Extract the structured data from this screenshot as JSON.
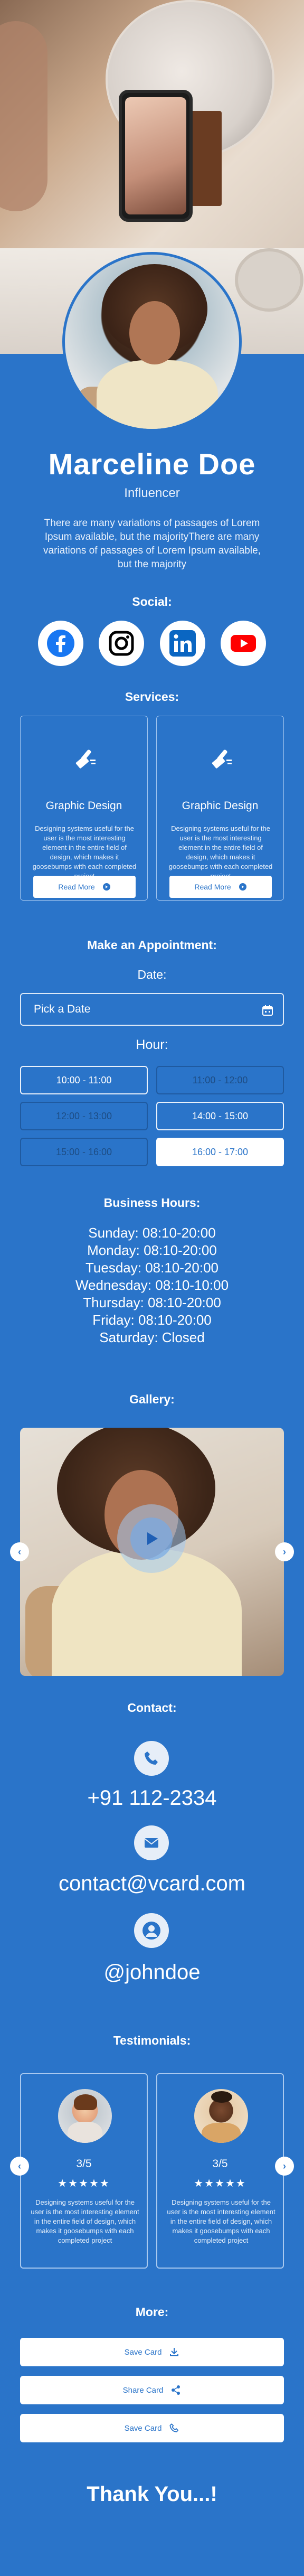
{
  "profile": {
    "name": "Marceline Doe",
    "role": "Influencer",
    "about": "There are many variations of passages of Lorem Ipsum available, but the majorityThere are many variations of passages of Lorem Ipsum available, but the majority"
  },
  "social": {
    "title": "Social:",
    "items": [
      {
        "icon": "facebook-icon",
        "color": "#1877f2"
      },
      {
        "icon": "instagram-icon",
        "color": "#000000"
      },
      {
        "icon": "linkedin-icon",
        "color": "#0a66c2"
      },
      {
        "icon": "youtube-icon",
        "color": "#ff0000"
      }
    ]
  },
  "services": {
    "title": "Services:",
    "items": [
      {
        "title": "Graphic Design",
        "description": "Designing systems useful for the user is the most interesting element in the entire field of design, which makes it goosebumps with each completed project",
        "button": "Read More"
      },
      {
        "title": "Graphic Design",
        "description": "Designing systems useful for the user is the most interesting element in the entire field of design, which makes it goosebumps with each completed project",
        "button": "Read More"
      }
    ]
  },
  "appointment": {
    "title": "Make an Appointment:",
    "date_label": "Date:",
    "date_placeholder": "Pick a Date",
    "hour_label": "Hour:",
    "slots": [
      {
        "label": "10:00 - 11:00",
        "state": "available"
      },
      {
        "label": "11:00 - 12:00",
        "state": "disabled"
      },
      {
        "label": "12:00 - 13:00",
        "state": "disabled"
      },
      {
        "label": "14:00 - 15:00",
        "state": "available"
      },
      {
        "label": "15:00 - 16:00",
        "state": "disabled"
      },
      {
        "label": "16:00 - 17:00",
        "state": "selected"
      }
    ]
  },
  "business_hours": {
    "title": "Business Hours:",
    "days": [
      "Sunday: 08:10-20:00",
      "Monday: 08:10-20:00",
      "Tuesday: 08:10-20:00",
      "Wednesday: 08:10-10:00",
      "Thursday: 08:10-20:00",
      "Friday: 08:10-20:00",
      "Saturday: Closed"
    ]
  },
  "gallery": {
    "title": "Gallery:"
  },
  "contact": {
    "title": "Contact:",
    "phone": "+91 112-2334",
    "email": "contact@vcard.com",
    "username": "@johndoe"
  },
  "testimonials": {
    "title": "Testimonials:",
    "items": [
      {
        "score": "3/5",
        "stars": "★★★★★",
        "description": "Designing systems useful for the user is the most interesting element in the entire field of design, which makes it goosebumps with each completed project"
      },
      {
        "score": "3/5",
        "stars": "★★★★★",
        "description": "Designing systems useful for the user is the most interesting element in the entire field of design, which makes it goosebumps with each completed project"
      }
    ]
  },
  "more": {
    "title": "More:",
    "buttons": [
      "Save Card",
      "Share Card",
      "Save Card"
    ]
  },
  "footer": {
    "thanks": "Thank You...!"
  },
  "colors": {
    "accent": "#2a74c9",
    "background": "#2a74c9",
    "card_border": "#9fc3ee"
  }
}
